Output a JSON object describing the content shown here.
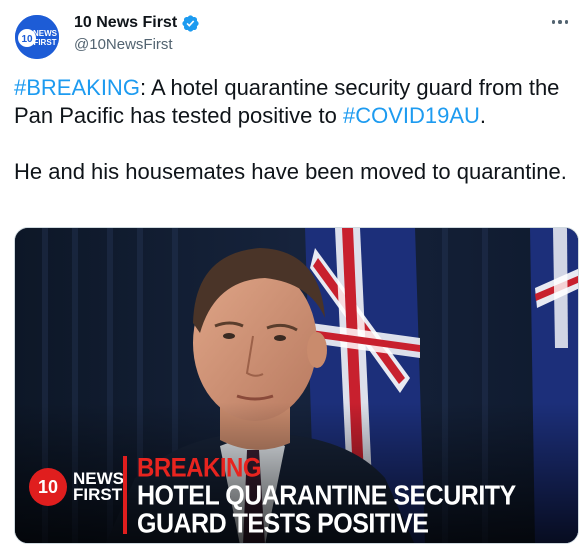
{
  "tweet": {
    "display_name": "10 News First",
    "handle": "@10NewsFirst",
    "avatar_label": "10 NEWS FIRST",
    "text": {
      "p1_hashtag1": "#BREAKING",
      "p1_text1": ": A hotel quarantine security guard from the Pan Pacific has tested positive to ",
      "p1_hashtag2": "#COVID19AU",
      "p1_text2": ".",
      "p2": "He and his housemates have been moved to quarantine."
    },
    "media": {
      "logo_number": "10",
      "logo_news": "NEWS",
      "logo_first": "FIRST",
      "kicker": "BREAKING",
      "headline_line1": "HOTEL QUARANTINE SECURITY",
      "headline_line2": "GUARD TESTS POSITIVE"
    }
  },
  "colors": {
    "link": "#1d9bf0",
    "verified": "#1d9bf0",
    "brand_red": "#e01e1e",
    "avatar_blue": "#1d5cd6"
  },
  "icons": {
    "verified": "verified-badge-icon",
    "more": "more-options-icon"
  }
}
